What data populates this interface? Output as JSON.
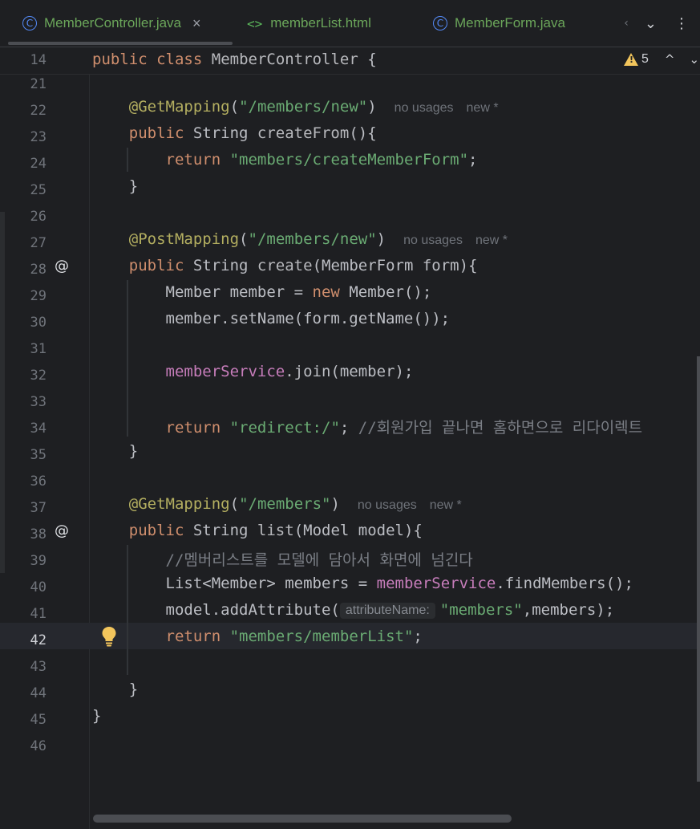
{
  "tabs": [
    {
      "icon": "c-class-icon",
      "label": "MemberController.java",
      "close": "×",
      "active": true
    },
    {
      "icon": "html-file-icon",
      "icon_glyph": "<>",
      "label": "memberList.html",
      "active": false
    },
    {
      "icon": "c-class-icon",
      "label": "MemberForm.java",
      "active": false
    }
  ],
  "tab_controls": {
    "scroll_left": "‹",
    "dropdown": "⌄",
    "more": "⋮"
  },
  "inspections": {
    "warning_count": "5",
    "up": "^",
    "down": "⌄"
  },
  "sticky_header": {
    "line": "14",
    "code_kw1": "public",
    "code_kw2": "class",
    "code_name": "MemberController",
    "code_brace": "{"
  },
  "line_numbers": [
    "21",
    "22",
    "23",
    "24",
    "25",
    "26",
    "27",
    "28",
    "29",
    "30",
    "31",
    "32",
    "33",
    "34",
    "35",
    "36",
    "37",
    "38",
    "39",
    "40",
    "41",
    "42",
    "43",
    "44",
    "45",
    "46"
  ],
  "current_line": "42",
  "code": {
    "l22_ann": "@GetMapping",
    "l22_paren_open": "(",
    "l22_str": "\"/members/new\"",
    "l22_paren_close": ")",
    "l22_usage": "no usages",
    "l22_new": "new *",
    "l23_kw": "public",
    "l23_type": " String ",
    "l23_name": "createFrom",
    "l23_rest": "(){",
    "l24_kw": "return",
    "l24_str": "\"members/createMemberForm\"",
    "l24_end": ";",
    "l25": "}",
    "l27_ann": "@PostMapping",
    "l27_paren_open": "(",
    "l27_str": "\"/members/new\"",
    "l27_paren_close": ")",
    "l27_usage": "no usages",
    "l27_new": "new *",
    "l28_kw": "public",
    "l28_type": " String ",
    "l28_name": "create",
    "l28_rest": "(MemberForm form){",
    "l29_a": "Member member = ",
    "l29_kw": "new",
    "l29_b": " Member();",
    "l30": "member.setName(form.getName());",
    "l32_field": "memberService",
    "l32_rest": ".join(member);",
    "l34_kw": "return",
    "l34_str": "\"redirect:/\"",
    "l34_semi": "; ",
    "l34_cmt": "//회원가입 끝나면 홈하면으로 리다이렉트",
    "l35": "}",
    "l37_ann": "@GetMapping",
    "l37_paren_open": "(",
    "l37_str": "\"/members\"",
    "l37_paren_close": ")",
    "l37_usage": "no usages",
    "l37_new": "new *",
    "l38_kw": "public",
    "l38_type": " String ",
    "l38_name": "list",
    "l38_rest": "(Model model){",
    "l39_cmt": "//멤버리스트를 모델에 담아서 화면에 넘긴다",
    "l40_a": "List<Member> members = ",
    "l40_field": "memberService",
    "l40_b": ".findMembers();",
    "l41_a": "model.addAttribute(",
    "l41_hint": "attributeName:",
    "l41_str": "\"members\"",
    "l41_b": ",members);",
    "l42_kw": "return",
    "l42_str": "\"members/memberList\"",
    "l42_end": ";",
    "l44": "}",
    "l45": "}"
  },
  "gutter_icons": {
    "l28": "@",
    "l38": "@"
  },
  "colors": {
    "keyword": "#cf8e6d",
    "string": "#6aab73",
    "annotation": "#b3ae60",
    "field": "#c77dbb",
    "comment": "#7a7e85",
    "background": "#1e1f22"
  }
}
